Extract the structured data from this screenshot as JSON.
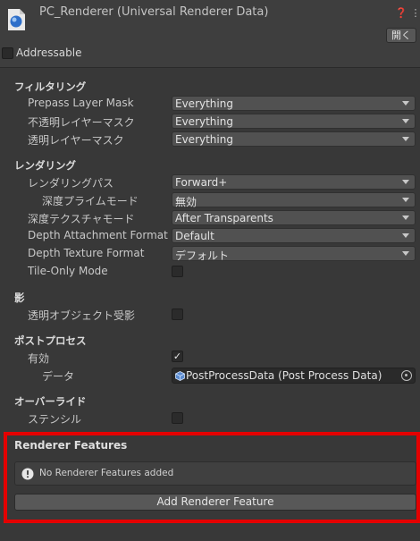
{
  "header": {
    "title": "PC_Renderer (Universal Renderer Data)",
    "help_icon": "question-icon",
    "menu_icon": "kebab-menu-icon",
    "open_button": "開く"
  },
  "addressable": {
    "label": "Addressable",
    "checked": false
  },
  "filtering": {
    "title": "フィルタリング",
    "prepass_layer_mask": {
      "label": "Prepass Layer Mask",
      "value": "Everything"
    },
    "opaque_layer_mask": {
      "label": "不透明レイヤーマスク",
      "value": "Everything"
    },
    "transparent_layer_mask": {
      "label": "透明レイヤーマスク",
      "value": "Everything"
    }
  },
  "rendering": {
    "title": "レンダリング",
    "rendering_path": {
      "label": "レンダリングパス",
      "value": "Forward+"
    },
    "depth_priming_mode": {
      "label": "深度プライムモード",
      "value": "無効"
    },
    "depth_texture_mode": {
      "label": "深度テクスチャモード",
      "value": "After Transparents"
    },
    "depth_attachment_format": {
      "label": "Depth Attachment Format",
      "value": "Default"
    },
    "depth_texture_format": {
      "label": "Depth Texture Format",
      "value": "デフォルト"
    },
    "tile_only_mode": {
      "label": "Tile-Only Mode",
      "checked": false
    }
  },
  "shadows": {
    "title": "影",
    "transparent_receive_shadows": {
      "label": "透明オブジェクト受影",
      "checked": false
    }
  },
  "post_processing": {
    "title": "ポストプロセス",
    "enabled": {
      "label": "有効",
      "checked": true,
      "check_mark": "✓"
    },
    "data": {
      "label": "データ",
      "value": "PostProcessData (Post Process Data)"
    }
  },
  "overrides": {
    "title": "オーバーライド",
    "stencil": {
      "label": "ステンシル",
      "checked": false
    }
  },
  "renderer_features": {
    "title": "Renderer Features",
    "empty_message": "No Renderer Features added",
    "add_button": "Add Renderer Feature"
  },
  "colors": {
    "background": "#383838",
    "highlight": "#e40000",
    "field": "#515151"
  }
}
